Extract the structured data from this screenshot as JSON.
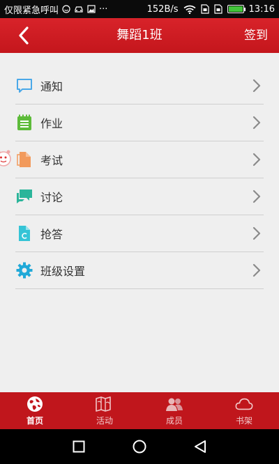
{
  "status_bar": {
    "carrier_text": "仅限紧急呼叫",
    "overflow": "···",
    "net_speed": "152B/s",
    "time": "13:16"
  },
  "header": {
    "title": "舞蹈1班",
    "right_action": "签到"
  },
  "menu": {
    "items": [
      {
        "label": "通知",
        "icon": "message-bubble-icon",
        "color": "#4aa8e8"
      },
      {
        "label": "作业",
        "icon": "notepad-icon",
        "color": "#5dbb3a"
      },
      {
        "label": "考试",
        "icon": "document-icon",
        "color": "#f29a5c"
      },
      {
        "label": "讨论",
        "icon": "chat-bubbles-icon",
        "color": "#2bb59a"
      },
      {
        "label": "抢答",
        "icon": "quiz-file-icon",
        "color": "#35c4d6"
      },
      {
        "label": "班级设置",
        "icon": "gear-icon",
        "color": "#21a9d8"
      }
    ]
  },
  "tabs": [
    {
      "label": "首页",
      "icon": "globe-icon",
      "active": true
    },
    {
      "label": "活动",
      "icon": "map-book-icon",
      "active": false
    },
    {
      "label": "成员",
      "icon": "members-icon",
      "active": false
    },
    {
      "label": "书架",
      "icon": "cloud-icon",
      "active": false
    }
  ],
  "colors": {
    "brand_red": "#c4161c",
    "status_bar": "#0b0b0b",
    "background": "#efefef",
    "battery": "#43c43a"
  }
}
